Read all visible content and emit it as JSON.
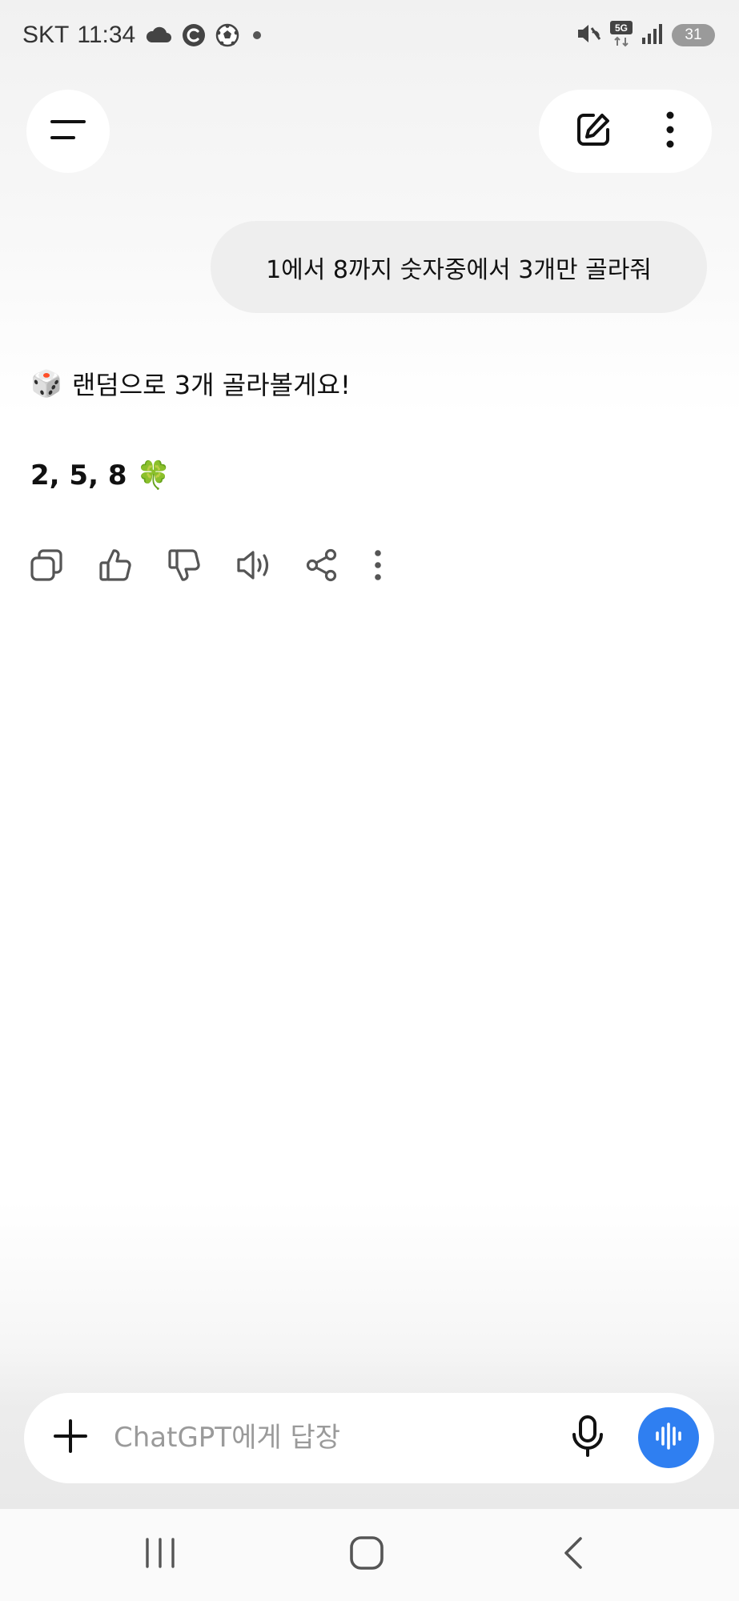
{
  "status_bar": {
    "carrier": "SKT",
    "time": "11:34",
    "network": "5G",
    "battery": "31",
    "icons": [
      "cloud-icon",
      "c-notification-icon",
      "soccer-ball-icon",
      "dot-icon",
      "mute-vibrate-icon",
      "5g-data-icon",
      "signal-icon",
      "battery-icon"
    ]
  },
  "header": {
    "menu_icon": "hamburger-menu-icon",
    "new_chat_icon": "edit-icon",
    "more_icon": "more-vertical-icon"
  },
  "conversation": {
    "user_message": "1에서 8까지 숫자중에서 3개만 골라줘",
    "assistant": {
      "emoji_intro": "🎲",
      "intro": "랜덤으로 3개 골라볼게요!",
      "numbers": "2, 5, 8",
      "emoji_numbers": "🍀"
    },
    "actions": [
      "copy-icon",
      "thumbs-up-icon",
      "thumbs-down-icon",
      "read-aloud-icon",
      "share-icon",
      "more-vertical-icon"
    ]
  },
  "composer": {
    "placeholder": "ChatGPT에게 답장",
    "value": ""
  },
  "colors": {
    "accent": "#2f7ff1",
    "bubble": "#eeeeee"
  }
}
